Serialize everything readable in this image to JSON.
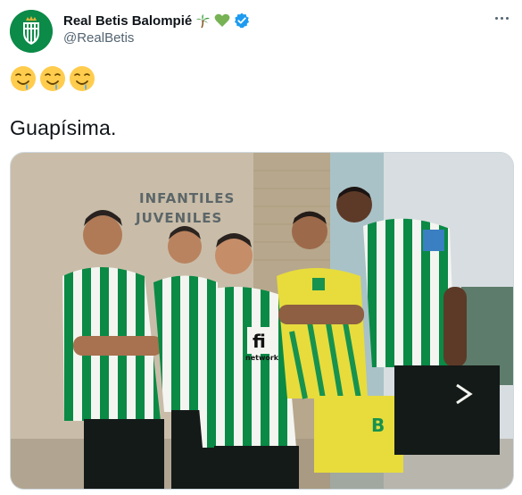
{
  "author": {
    "display_name": "Real Betis Balompié",
    "handle": "@RealBetis",
    "verified": true,
    "badges": [
      "palm-tree-emoji",
      "green-heart-emoji",
      "verified-badge-icon"
    ]
  },
  "tweet": {
    "emojis": [
      "drooling-face-emoji",
      "drooling-face-emoji",
      "drooling-face-emoji"
    ],
    "text": "Guapísima.",
    "menu_icon": "more-options-icon"
  },
  "media": {
    "wall_sign": [
      "INFANTILES",
      "JUVENILES"
    ],
    "sponsor_text": "network",
    "sponsor_logo_text": "fi",
    "colors": {
      "kit_green": "#0a8a45",
      "kit_white": "#f4f5f1",
      "kit_yellow": "#e7dc3c",
      "wall": "#cfc4b4",
      "sky": "#d7dde0"
    }
  },
  "colors": {
    "verified_blue": "#1d9bf0",
    "avatar_green": "#0c8a48",
    "handle_gray": "#536471"
  }
}
